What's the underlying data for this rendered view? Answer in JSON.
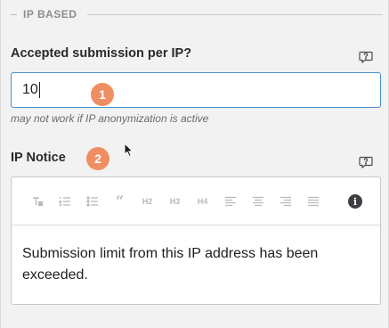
{
  "section": {
    "title": "IP BASED"
  },
  "submission_limit": {
    "label": "Accepted submission per IP?",
    "value": "10",
    "hint": "may not work if IP anonymization is active",
    "step_badge": "1",
    "help_icon": "help-bubble-icon"
  },
  "ip_notice": {
    "label": "IP Notice",
    "step_badge": "2",
    "help_icon": "help-bubble-icon",
    "toolbar": [
      {
        "name": "clear-format-icon",
        "glyph": ""
      },
      {
        "name": "ordered-list-icon",
        "glyph": ""
      },
      {
        "name": "unordered-list-icon",
        "glyph": ""
      },
      {
        "name": "blockquote-icon",
        "glyph": "“"
      },
      {
        "name": "heading-2-icon",
        "glyph": "H2"
      },
      {
        "name": "heading-3-icon",
        "glyph": "H3"
      },
      {
        "name": "heading-4-icon",
        "glyph": "H4"
      },
      {
        "name": "align-left-icon",
        "glyph": ""
      },
      {
        "name": "align-center-icon",
        "glyph": ""
      },
      {
        "name": "align-right-icon",
        "glyph": ""
      },
      {
        "name": "align-justify-icon",
        "glyph": ""
      }
    ],
    "info_glyph": "i",
    "content": "Submission limit from this IP address has been exceeded."
  },
  "colors": {
    "accent_border": "#4a8fd0",
    "badge": "#f08e63",
    "background": "#f2f2f3"
  }
}
